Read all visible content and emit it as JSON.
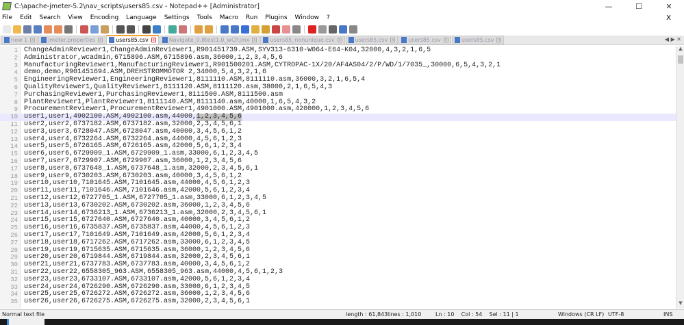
{
  "window": {
    "title": "C:\\apache-jmeter-5.2\\nav_scripts\\users85.csv - Notepad++ [Administrator]"
  },
  "menu": [
    "File",
    "Edit",
    "Search",
    "View",
    "Encoding",
    "Language",
    "Settings",
    "Tools",
    "Macro",
    "Run",
    "Plugins",
    "Window",
    "?"
  ],
  "menu_close": "X",
  "tabs": [
    {
      "label": "new 1",
      "active": false
    },
    {
      "label": "jmeter.properties",
      "active": false
    },
    {
      "label": "users85.csv",
      "active": true
    },
    {
      "label": "Navigate_0.8test1.0_wCP.jmx",
      "active": false
    },
    {
      "label": "users85_nonunique.csv",
      "active": false
    },
    {
      "label": "users85.csv",
      "active": false
    },
    {
      "label": "users85.csv",
      "active": false
    },
    {
      "label": "users85.csv",
      "active": false
    }
  ],
  "editor": {
    "current_line": 10,
    "selection": {
      "line": 10,
      "text": "1,2,3,4,5,6"
    },
    "lines": [
      "ChangeAdminReviewer1,ChangeAdminReviewer1,R901451739.ASM,SYV313-6310-W064-E64-K04,32000,4,3,2,1,6,5",
      "Administrator,wcadmin,6715896.ASM,6715896.asm,36000,1,2,3,4,5,6",
      "ManufacturingReviewer1,ManufacturingReviewer1,R901500201.ASM,CYTROPAC-1X/20/AF4AS04/2/P/WD/1/7035_,30000,6,5,4,3,2,1",
      "demo,demo,R901451694.ASM,DREHSTROMMOTOR 2,34000,5,4,3,2,1,6",
      "EngineeringReviewer1,EngineeringReviewer1,8111110.ASM,8111110.asm,36000,3,2,1,6,5,4",
      "QualityReviewer1,QualityReviewer1,8111120.ASM,8111120.asm,38000,2,1,6,5,4,3",
      "PurchasingReviewer1,PurchasingReviewer1,8111500.ASM,8111500.asm",
      "PlantReviewer1,PlantReviewer1,8111140.ASM,8111140.asm,40000,1,6,5,4,3,2",
      "ProcurementReviewer1,ProcurementReviewer1,4901000.ASM,4901000.asm,420000,1,2,3,4,5,6",
      "user1,user1,4902100.ASM,4902100.asm,44000,1,2,3,4,5,6",
      "user2,user2,6737182.ASM,6737182.asm,32000,2,3,4,5,6,1",
      "user3,user3,6728047.ASM,6728047.asm,40000,3,4,5,6,1,2",
      "user4,user4,6732264.ASM,6732264.asm,44000,4,5,6,1,2,3",
      "user5,user5,6726165.ASM,6726165.asm,42000,5,6,1,2,3,4",
      "user6,user6,6729909_1.ASM,6729909_1.asm,33000,6,1,2,3,4,5",
      "user7,user7,6729907.ASM,6729907.asm,36000,1,2,3,4,5,6",
      "user8,user8,6737648_1.ASM,6737648_1.asm,32000,2,3,4,5,6,1",
      "user9,user9,6730203.ASM,6730203.asm,40000,3,4,5,6,1,2",
      "user10,user10,7101645.ASM,7101645.asm,44000,4,5,6,1,2,3",
      "user11,user11,7101646.ASM,7101646.asm,42000,5,6,1,2,3,4",
      "user12,user12,6727705_1.ASM,6727705_1.asm,33000,6,1,2,3,4,5",
      "user13,user13,6730202.ASM,6730202.asm,36000,1,2,3,4,5,6",
      "user14,user14,6736213_1.ASM,6736213_1.asm,32000,2,3,4,5,6,1",
      "user15,user15,6727640.ASM,6727640.asm,40000,3,4,5,6,1,2",
      "user16,user16,6735837.ASM,6735837.asm,44000,4,5,6,1,2,3",
      "user17,user17,7101649.ASM,7101649.asm,42000,5,6,1,2,3,4",
      "user18,user18,6717262.ASM,6717262.asm,33000,6,1,2,3,4,5",
      "user19,user19,6715635.ASM,6715635.asm,36000,1,2,3,4,5,6",
      "user20,user20,6719844.ASM,6719844.asm,32000,2,3,4,5,6,1",
      "user21,user21,6737783.ASM,6737783.asm,40000,3,4,5,6,1,2",
      "user22,user22,6558305_963.ASM,6558305_963.asm,44000,4,5,6,1,2,3",
      "user23,user23,6733107.ASM,6733107.asm,42000,5,6,1,2,3,4",
      "user24,user24,6726290.ASM,6726290.asm,33000,6,1,2,3,4,5",
      "user25,user25,6726272.ASM,6726272.asm,36000,1,2,3,4,5,6",
      "user26,user26,6726275.ASM,6726275.asm,32000,2,3,4,5,6,1"
    ]
  },
  "status": {
    "file_type": "Normal text file",
    "length": "length : 61,843",
    "lines": "lines : 1,010",
    "position": "Ln : 10    Col : 54    Sel : 11 | 1",
    "eol": "Windows (CR LF)",
    "encoding": "UTF-8",
    "mode": "INS"
  }
}
